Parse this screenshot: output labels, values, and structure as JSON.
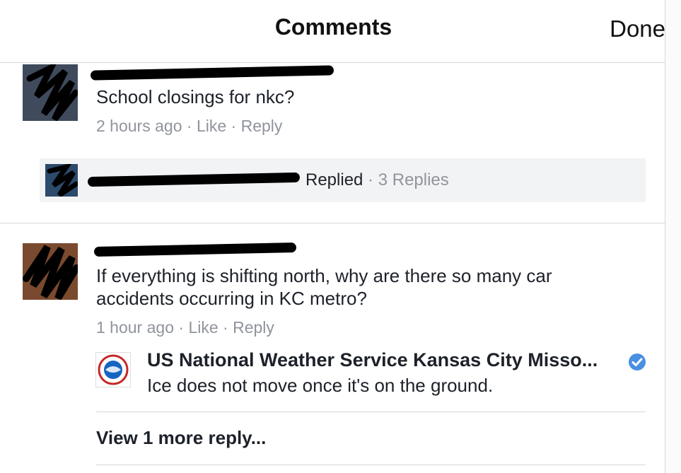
{
  "header": {
    "title": "Comments",
    "done_label": "Done"
  },
  "comments": [
    {
      "text": "School closings for nkc?",
      "time": "2 hours ago",
      "like_label": "Like",
      "reply_label": "Reply",
      "replied": {
        "label": "Replied",
        "count_label": "3 Replies"
      }
    },
    {
      "text": "If everything is shifting north, why are there so many car accidents occurring in KC metro?",
      "time": "1 hour ago",
      "like_label": "Like",
      "reply_label": "Reply",
      "reply": {
        "author": "US National Weather Service Kansas City Misso...",
        "text": "Ice does not move once it's on the ground.",
        "verified": true
      },
      "view_more_label": "View 1 more reply..."
    }
  ],
  "separator": " · ",
  "colors": {
    "verified_badge": "#4a90e2",
    "meta_text": "#90949c",
    "replied_bg": "#f2f3f5"
  }
}
